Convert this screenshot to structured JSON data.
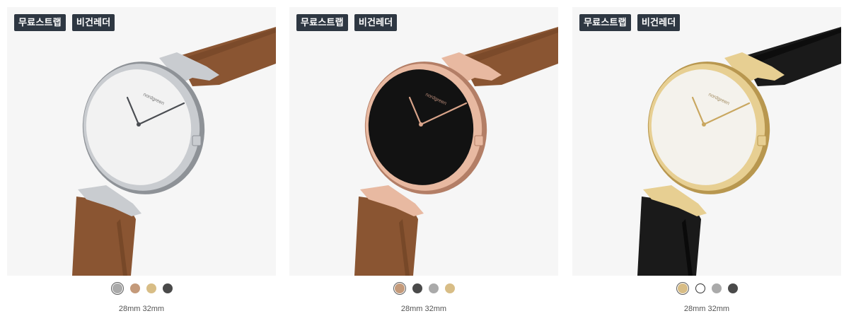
{
  "products": [
    {
      "badges": [
        "무료스트랩",
        "비건레더"
      ],
      "colors": {
        "case": "#c9ccd0",
        "case_dark": "#8e9297",
        "dial": "#f2f2f2",
        "hands": "#4a4d52",
        "strap": "#8a5532",
        "strap_dark": "#6b3f22",
        "logo": "#777"
      },
      "swatches": [
        {
          "color": "#aaaaaa",
          "selected": true
        },
        {
          "color": "#c49a7a",
          "selected": false
        },
        {
          "color": "#d8bd86",
          "selected": false
        },
        {
          "color": "#4a4a4a",
          "selected": false
        }
      ],
      "sizes": "28mm 32mm"
    },
    {
      "badges": [
        "무료스트랩",
        "비건레더"
      ],
      "colors": {
        "case": "#e8b9a1",
        "case_dark": "#b37e66",
        "dial": "#121212",
        "hands": "#d9a48a",
        "strap": "#8a5532",
        "strap_dark": "#6b3f22",
        "logo": "#b98a78"
      },
      "swatches": [
        {
          "color": "#c49a7a",
          "selected": true
        },
        {
          "color": "#4a4a4a",
          "selected": false
        },
        {
          "color": "#aaaaaa",
          "selected": false
        },
        {
          "color": "#d8bd86",
          "selected": false
        }
      ],
      "sizes": "28mm 32mm"
    },
    {
      "badges": [
        "무료스트랩",
        "비건레더"
      ],
      "colors": {
        "case": "#e7cf92",
        "case_dark": "#b8974f",
        "dial": "#f4f2ec",
        "hands": "#c9a760",
        "strap": "#1a1a1a",
        "strap_dark": "#000000",
        "logo": "#a38d63"
      },
      "swatches": [
        {
          "color": "#d8bd86",
          "selected": true
        },
        {
          "color": "#ffffff",
          "selected": false,
          "outlined": true
        },
        {
          "color": "#aaaaaa",
          "selected": false
        },
        {
          "color": "#4a4a4a",
          "selected": false
        }
      ],
      "sizes": "28mm 32mm"
    }
  ]
}
